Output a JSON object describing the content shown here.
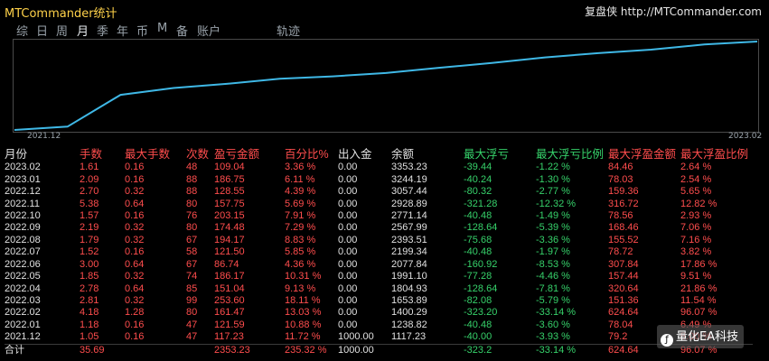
{
  "title": "MTCommander统计",
  "brand": {
    "name": "复盘侠",
    "url": "http://MTCommander.com"
  },
  "tabs": [
    "综",
    "日",
    "周",
    "月",
    "季",
    "年",
    "币",
    "M",
    "备",
    "账户",
    "轨迹"
  ],
  "active_tab": "月",
  "chart_data": {
    "type": "line",
    "x": [
      "2021.12",
      "2022.01",
      "2022.02",
      "2022.03",
      "2022.04",
      "2022.05",
      "2022.06",
      "2022.07",
      "2022.08",
      "2022.09",
      "2022.10",
      "2022.11",
      "2022.12",
      "2023.01",
      "2023.02"
    ],
    "y": [
      117.23,
      238.82,
      1400.29,
      1653.89,
      1804.93,
      1991.1,
      2077.84,
      2199.34,
      2393.51,
      2567.99,
      2771.14,
      2928.89,
      3057.44,
      3244.19,
      3353.23
    ],
    "x_tick_labels": [
      "2021.12",
      "2023.02"
    ],
    "line_color": "#3fb8e6",
    "grid": false
  },
  "table": {
    "headers": [
      "月份",
      "手数",
      "最大手数",
      "次数",
      "盈亏金额",
      "百分比%",
      "出入金",
      "余额",
      "最大浮亏",
      "最大浮亏比例",
      "最大浮盈金额",
      "最大浮盈比例"
    ],
    "rows": [
      [
        "2023.02",
        "1.61",
        "0.16",
        "48",
        "109.04",
        "3.36 %",
        "0.00",
        "3353.23",
        "-39.44",
        "-1.22 %",
        "84.46",
        "2.64 %"
      ],
      [
        "2023.01",
        "2.09",
        "0.16",
        "88",
        "186.75",
        "6.11 %",
        "0.00",
        "3244.19",
        "-40.24",
        "-1.30 %",
        "78.03",
        "2.54 %"
      ],
      [
        "2022.12",
        "2.70",
        "0.32",
        "88",
        "128.55",
        "4.39 %",
        "0.00",
        "3057.44",
        "-80.32",
        "-2.77 %",
        "159.36",
        "5.65 %"
      ],
      [
        "2022.11",
        "5.38",
        "0.64",
        "80",
        "157.75",
        "5.69 %",
        "0.00",
        "2928.89",
        "-321.28",
        "-12.32 %",
        "316.72",
        "12.82 %"
      ],
      [
        "2022.10",
        "1.57",
        "0.16",
        "76",
        "203.15",
        "7.91 %",
        "0.00",
        "2771.14",
        "-40.48",
        "-1.49 %",
        "78.56",
        "2.93 %"
      ],
      [
        "2022.09",
        "2.19",
        "0.32",
        "80",
        "174.48",
        "7.29 %",
        "0.00",
        "2567.99",
        "-128.64",
        "-5.39 %",
        "168.46",
        "7.06 %"
      ],
      [
        "2022.08",
        "1.79",
        "0.32",
        "67",
        "194.17",
        "8.83 %",
        "0.00",
        "2393.51",
        "-75.68",
        "-3.36 %",
        "155.52",
        "7.16 %"
      ],
      [
        "2022.07",
        "1.52",
        "0.16",
        "58",
        "121.50",
        "5.85 %",
        "0.00",
        "2199.34",
        "-40.48",
        "-1.97 %",
        "78.72",
        "3.82 %"
      ],
      [
        "2022.06",
        "3.00",
        "0.64",
        "67",
        "86.74",
        "4.36 %",
        "0.00",
        "2077.84",
        "-160.92",
        "-8.53 %",
        "307.84",
        "17.86 %"
      ],
      [
        "2022.05",
        "1.85",
        "0.32",
        "74",
        "186.17",
        "10.31 %",
        "0.00",
        "1991.10",
        "-77.28",
        "-4.46 %",
        "157.44",
        "9.51 %"
      ],
      [
        "2022.04",
        "2.78",
        "0.64",
        "85",
        "151.04",
        "9.13 %",
        "0.00",
        "1804.93",
        "-128.64",
        "-7.81 %",
        "320.64",
        "21.86 %"
      ],
      [
        "2022.03",
        "2.81",
        "0.32",
        "99",
        "253.60",
        "18.11 %",
        "0.00",
        "1653.89",
        "-82.08",
        "-5.79 %",
        "151.36",
        "11.54 %"
      ],
      [
        "2022.02",
        "4.18",
        "1.28",
        "80",
        "161.47",
        "13.03 %",
        "0.00",
        "1400.29",
        "-323.20",
        "-33.14 %",
        "624.64",
        "96.07 %"
      ],
      [
        "2022.01",
        "1.18",
        "0.16",
        "47",
        "121.59",
        "10.88 %",
        "0.00",
        "1238.82",
        "-40.48",
        "-3.60 %",
        "78.04",
        "6.49 %"
      ],
      [
        "2021.12",
        "1.05",
        "0.16",
        "47",
        "117.23",
        "11.72 %",
        "1000.00",
        "1117.23",
        "-40.00",
        "-3.93 %",
        "79.2",
        "8.00 %"
      ]
    ],
    "total": [
      "合计",
      "35.69",
      "",
      "",
      "2353.23",
      "235.32 %",
      "1000.00",
      "",
      "-323.2",
      "-33.14 %",
      "624.64",
      "96.07 %"
    ]
  },
  "watermark": "量化EA科技",
  "colors": {
    "background": "#000000",
    "title": "#ffd24a",
    "loss_red": "#ff4d4d",
    "gain_green": "#36d16a",
    "line": "#3fb8e6",
    "border": "#4a4a4a"
  }
}
